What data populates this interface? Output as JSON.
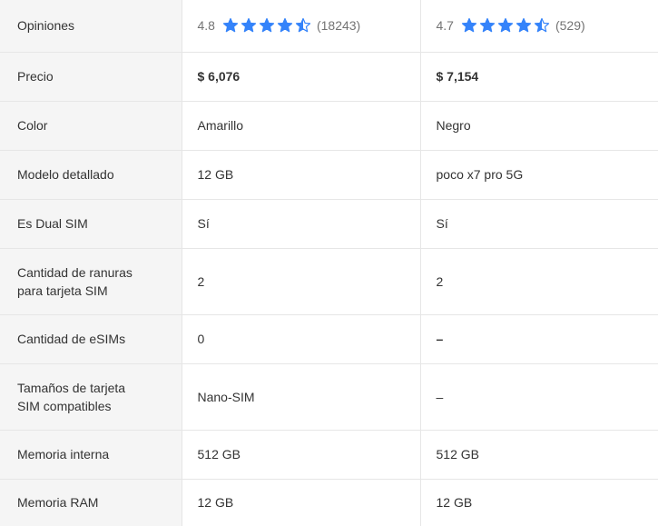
{
  "rows": {
    "opiniones": {
      "label": "Opiniones",
      "a": {
        "score": "4.8",
        "count": "(18243)",
        "stars": 4.5
      },
      "b": {
        "score": "4.7",
        "count": "(529)",
        "stars": 4.5
      }
    },
    "precio": {
      "label": "Precio",
      "a": "$ 6,076",
      "b": "$ 7,154"
    },
    "color": {
      "label": "Color",
      "a": "Amarillo",
      "b": "Negro"
    },
    "modelo": {
      "label": "Modelo detallado",
      "a": "12 GB",
      "b": "poco x7 pro 5G"
    },
    "dual_sim": {
      "label": "Es Dual SIM",
      "a": "Sí",
      "b": "Sí"
    },
    "ranuras": {
      "label_line1": "Cantidad de ranuras",
      "label_line2": "para tarjeta SIM",
      "a": "2",
      "b": "2"
    },
    "esims": {
      "label": "Cantidad de eSIMs",
      "a": "0",
      "b": "–"
    },
    "tamanos": {
      "label_line1": "Tamaños de tarjeta",
      "label_line2": "SIM compatibles",
      "a": "Nano-SIM",
      "b": "–"
    },
    "memoria_interna": {
      "label": "Memoria interna",
      "a": "512 GB",
      "b": "512 GB"
    },
    "memoria_ram": {
      "label": "Memoria RAM",
      "a": "12 GB",
      "b": "12 GB"
    }
  },
  "colors": {
    "star": "#3483fa",
    "label_bg": "#f5f5f5",
    "border": "#e6e6e6",
    "text": "#333333",
    "muted": "#737373"
  },
  "icons": {
    "rating": "star-icon"
  }
}
